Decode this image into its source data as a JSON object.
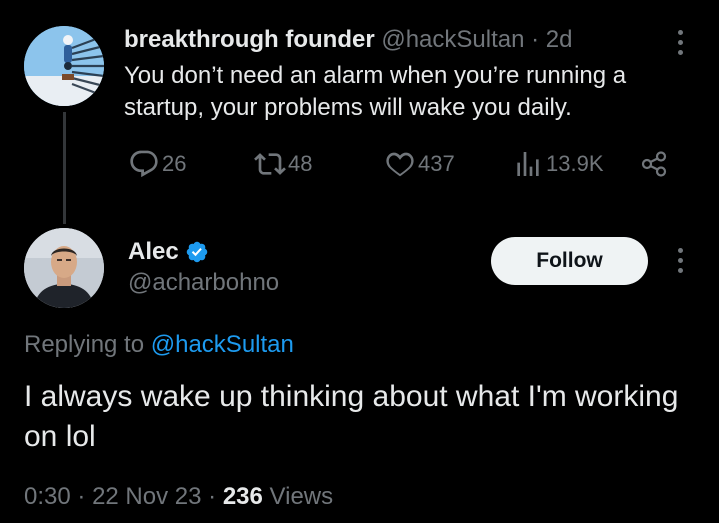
{
  "parent_tweet": {
    "author_name": "breakthrough founder",
    "handle": "@hackSultan",
    "separator": "·",
    "age": "2d",
    "text": "You don’t need an alarm when you’re running a startup, your problems will wake you daily.",
    "stats": {
      "replies": "26",
      "retweets": "48",
      "likes": "437",
      "views": "13.9K"
    }
  },
  "reply_tweet": {
    "author_name": "Alec",
    "handle": "@acharbohno",
    "verified": true,
    "follow_label": "Follow",
    "replying_prefix": "Replying to",
    "replying_to": "@hackSultan",
    "text": "I always wake up thinking about what I'm working on lol",
    "time": "0:30",
    "date": "22 Nov 23",
    "separator": "·",
    "views_count": "236",
    "views_label": "Views"
  },
  "colors": {
    "background": "#000000",
    "text_primary": "#e7e9ea",
    "text_muted": "#71767b",
    "accent": "#1d9bf0",
    "follow_button_bg": "#eff3f4"
  },
  "icons": {
    "reply": "reply-icon",
    "retweet": "retweet-icon",
    "like": "heart-icon",
    "views": "analytics-icon",
    "share": "share-icon",
    "more": "more-dots-icon",
    "verified": "verified-badge-icon"
  }
}
